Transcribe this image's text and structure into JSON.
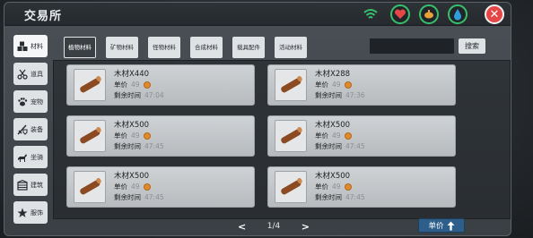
{
  "window": {
    "title": "交易所"
  },
  "header_buttons": [
    {
      "name": "heart-icon",
      "color": "#e54747"
    },
    {
      "name": "food-icon",
      "color": "#e8a23a"
    },
    {
      "name": "water-drop-icon",
      "color": "#2f9fdc"
    }
  ],
  "close_label": "✕",
  "sidebar": {
    "items": [
      {
        "label": "材料",
        "icon": "cubes-icon",
        "active": true
      },
      {
        "label": "道具",
        "icon": "scissors-icon",
        "active": false
      },
      {
        "label": "宠物",
        "icon": "paw-icon",
        "active": false
      },
      {
        "label": "装备",
        "icon": "sword-shield-icon",
        "active": false
      },
      {
        "label": "坐骑",
        "icon": "horse-icon",
        "active": false
      },
      {
        "label": "建筑",
        "icon": "building-icon",
        "active": false
      },
      {
        "label": "服饰",
        "icon": "star-icon",
        "active": false
      }
    ]
  },
  "tabs": [
    {
      "label": "植物材料",
      "active": true
    },
    {
      "label": "矿物材料",
      "active": false
    },
    {
      "label": "怪物材料",
      "active": false
    },
    {
      "label": "合成材料",
      "active": false
    },
    {
      "label": "载具配件",
      "active": false
    },
    {
      "label": "活动材料",
      "active": false
    }
  ],
  "search": {
    "placeholder": "",
    "button_label": "搜索"
  },
  "listings": [
    {
      "name": "木材X440",
      "price_label": "单价",
      "price": "49",
      "time_label": "剩余时间",
      "time": "47:04"
    },
    {
      "name": "木材X288",
      "price_label": "单价",
      "price": "49",
      "time_label": "剩余时间",
      "time": "47:36"
    },
    {
      "name": "木材X500",
      "price_label": "单价",
      "price": "49",
      "time_label": "剩余时间",
      "time": "47:45"
    },
    {
      "name": "木材X500",
      "price_label": "单价",
      "price": "49",
      "time_label": "剩余时间",
      "time": "47:45"
    },
    {
      "name": "木材X500",
      "price_label": "单价",
      "price": "49",
      "time_label": "剩余时间",
      "time": "47:45"
    },
    {
      "name": "木材X500",
      "price_label": "单价",
      "price": "49",
      "time_label": "剩余时间",
      "time": "47:45"
    }
  ],
  "pagination": {
    "prev": "<",
    "page": "1/4",
    "next": ">"
  },
  "sort": {
    "label": "单价",
    "icon": "arrow-up-icon"
  },
  "colors": {
    "accent_green": "#37c06a",
    "close_red": "#e54747",
    "sort_blue": "#2e5f8a",
    "coin_orange": "#e08a2d"
  }
}
